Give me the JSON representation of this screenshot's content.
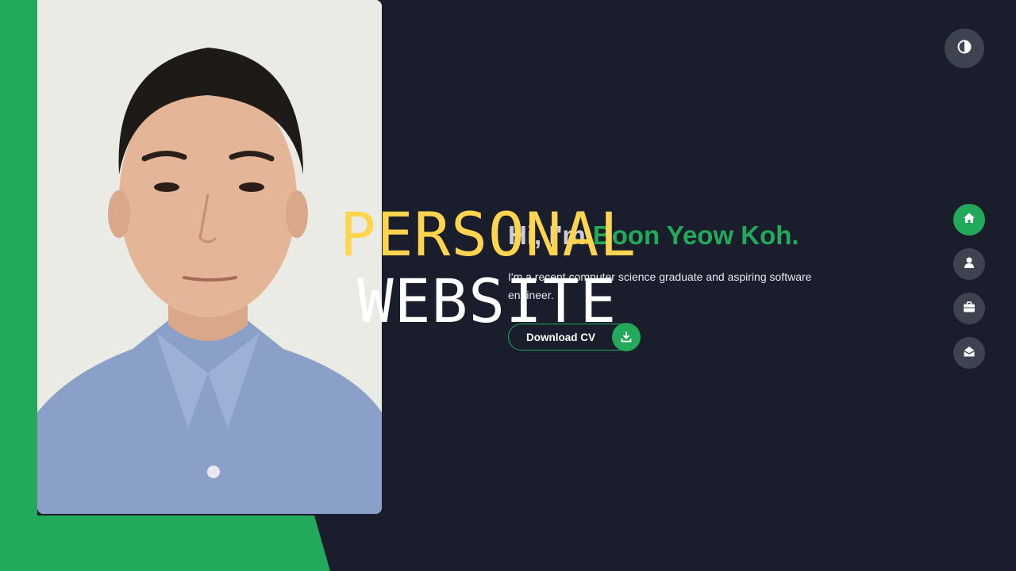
{
  "overlay": {
    "line1": "PERSONAL",
    "line2": "WEBSITE"
  },
  "hero": {
    "greeting": "Hi, I'm ",
    "name": "Boon Yeow Koh.",
    "description": "I'm a recent computer science graduate and aspiring software engineer."
  },
  "buttons": {
    "download_cv": "Download CV"
  },
  "nav": [
    {
      "id": "home",
      "icon": "home-icon",
      "active": true
    },
    {
      "id": "about",
      "icon": "user-icon",
      "active": false
    },
    {
      "id": "portfolio",
      "icon": "briefcase-icon",
      "active": false
    },
    {
      "id": "contact",
      "icon": "envelope-open-icon",
      "active": false
    }
  ],
  "colors": {
    "accent": "#22a95a",
    "background": "#1a1d2b",
    "overlay_yellow": "#ffd54f",
    "icon_bg": "#3e444f"
  }
}
